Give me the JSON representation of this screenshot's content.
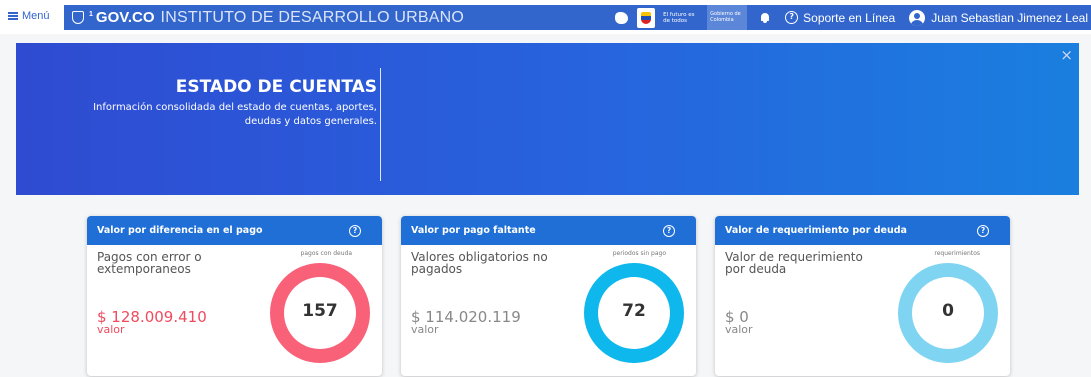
{
  "topbar": {
    "menu_label": "Menú",
    "gov_brand": "GOV.CO",
    "gov_brand_sup": "1",
    "institution": "INSTITUTO DE DESARROLLO URBANO",
    "futuro_text": "El futuro es de todos",
    "gobierno_text": "Gobierno de Colombia",
    "support_label": "Soporte en Línea",
    "user_name": "Juan Sebastian Jimenez Leal"
  },
  "banner": {
    "title": "ESTADO DE CUENTAS",
    "description": "Información consolidada del estado de cuentas, aportes, deudas y datos generales.",
    "close_symbol": "×"
  },
  "cards": [
    {
      "title": "Valor por diferencia en el pago",
      "help": "?",
      "label": "Pagos con error o extemporaneos",
      "amount": "$ 128.009.410",
      "amount_caption": "valor",
      "donut_caption": "pagos con deuda",
      "donut_value": "157",
      "accent": "#f24d6b",
      "amount_color": "#ef4b5e"
    },
    {
      "title": "Valor por pago faltante",
      "help": "?",
      "label": "Valores obligatorios no pagados",
      "amount": "$ 114.020.119",
      "amount_caption": "valor",
      "donut_caption": "periodos sin pago",
      "donut_value": "72",
      "accent": "#0eb8ec",
      "amount_color": "#8a8a8a"
    },
    {
      "title": "Valor de requerimiento por deuda",
      "help": "?",
      "label": "Valor de requerimiento por deuda",
      "amount": "$ 0",
      "amount_caption": "valor",
      "donut_caption": "requerimientos",
      "donut_value": "0",
      "accent": "#7fd4f2",
      "amount_color": "#8a8a8a"
    }
  ],
  "colors": {
    "gov_blue": "#3366cc",
    "card_header": "#1f6fd6"
  }
}
